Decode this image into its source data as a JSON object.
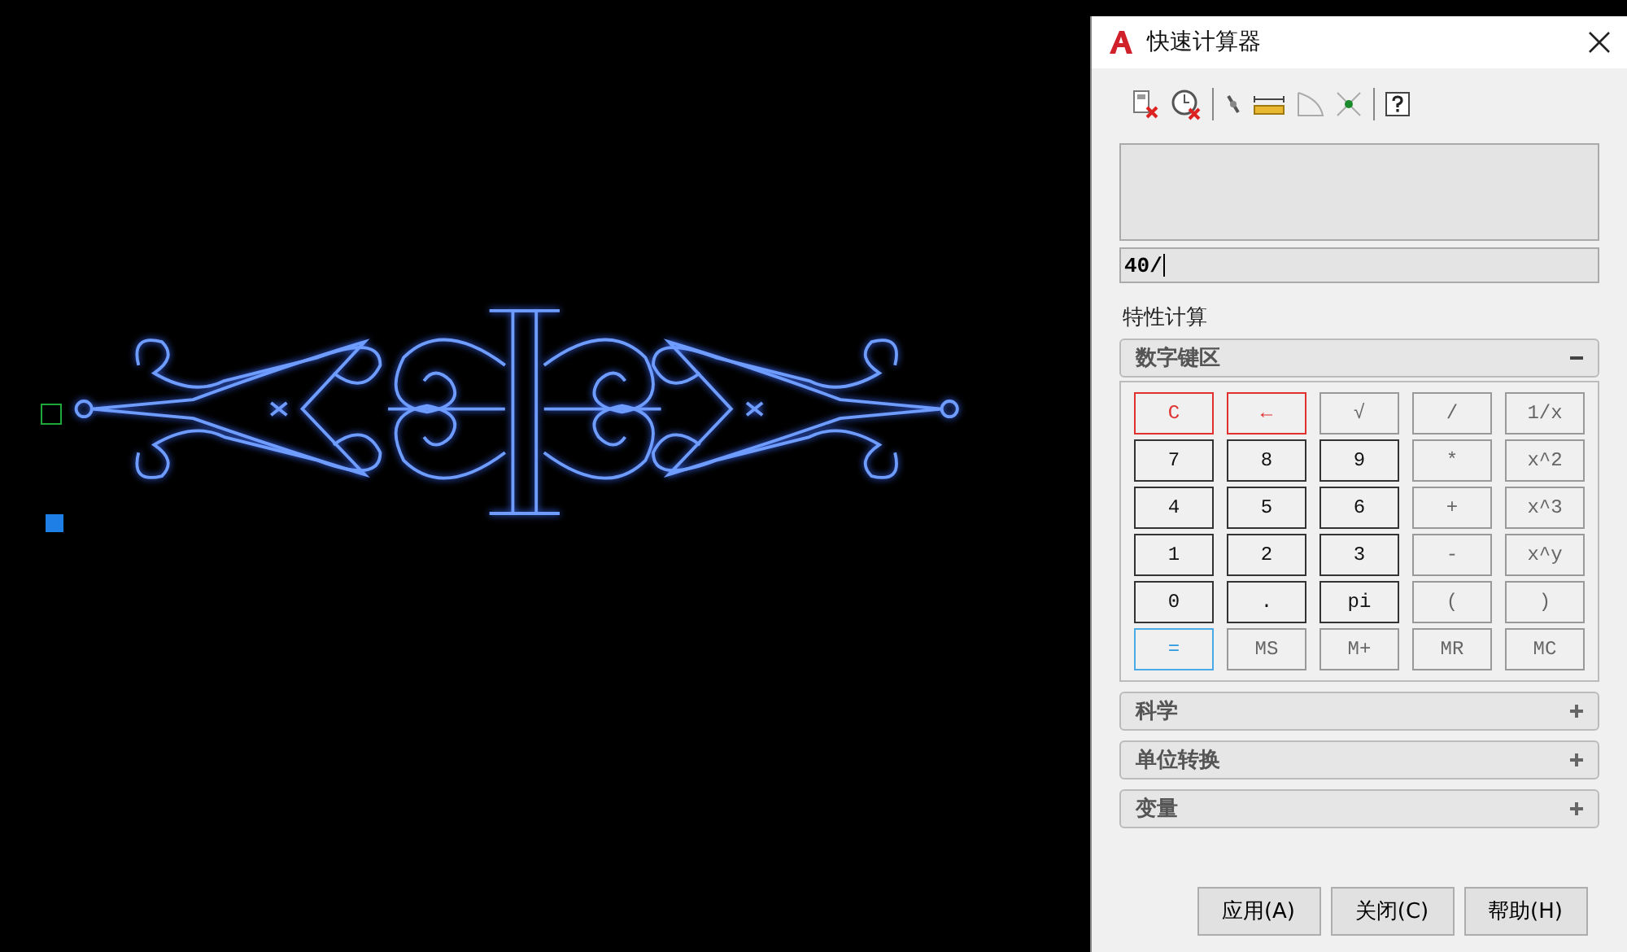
{
  "window": {
    "title": "快速计算器"
  },
  "input": {
    "value": "40/"
  },
  "property_label": "特性计算",
  "sections": [
    {
      "label": "数字键区",
      "expanded": true,
      "keys": [
        {
          "label": "C",
          "kind": "clear"
        },
        {
          "label": "←",
          "kind": "clear"
        },
        {
          "label": "√",
          "kind": "op"
        },
        {
          "label": "/",
          "kind": "op"
        },
        {
          "label": "1/x",
          "kind": "op"
        },
        {
          "label": "7",
          "kind": "digit"
        },
        {
          "label": "8",
          "kind": "digit"
        },
        {
          "label": "9",
          "kind": "digit"
        },
        {
          "label": "*",
          "kind": "op"
        },
        {
          "label": "x^2",
          "kind": "op"
        },
        {
          "label": "4",
          "kind": "digit"
        },
        {
          "label": "5",
          "kind": "digit"
        },
        {
          "label": "6",
          "kind": "digit"
        },
        {
          "label": "+",
          "kind": "op"
        },
        {
          "label": "x^3",
          "kind": "op"
        },
        {
          "label": "1",
          "kind": "digit"
        },
        {
          "label": "2",
          "kind": "digit"
        },
        {
          "label": "3",
          "kind": "digit"
        },
        {
          "label": "-",
          "kind": "op"
        },
        {
          "label": "x^y",
          "kind": "op"
        },
        {
          "label": "0",
          "kind": "digit"
        },
        {
          "label": ".",
          "kind": "digit"
        },
        {
          "label": "pi",
          "kind": "digit"
        },
        {
          "label": "(",
          "kind": "op"
        },
        {
          "label": ")",
          "kind": "op"
        },
        {
          "label": "=",
          "kind": "equals"
        },
        {
          "label": "MS",
          "kind": "op"
        },
        {
          "label": "M+",
          "kind": "op"
        },
        {
          "label": "MR",
          "kind": "op"
        },
        {
          "label": "MC",
          "kind": "op"
        }
      ]
    },
    {
      "label": "科学",
      "expanded": false
    },
    {
      "label": "单位转换",
      "expanded": false
    },
    {
      "label": "变量",
      "expanded": false
    }
  ],
  "buttons": [
    "应用(A)",
    "关闭(C)",
    "帮助(H)"
  ]
}
